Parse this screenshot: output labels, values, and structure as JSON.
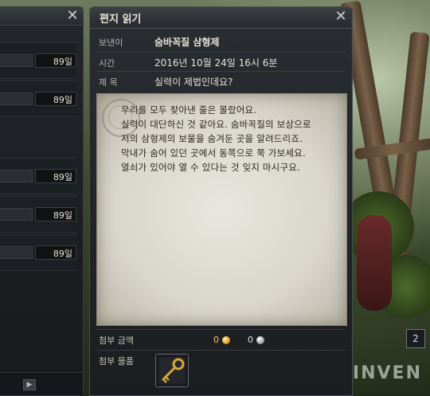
{
  "left_panel": {
    "rows": [
      {
        "days": "89일"
      },
      {
        "days": "89일"
      },
      {
        "days": "89일"
      },
      {
        "days": "89일"
      },
      {
        "days": "89일"
      }
    ],
    "close_label": "✕",
    "pager_next_label": "▶"
  },
  "letter": {
    "title": "편지 읽기",
    "close_label": "✕",
    "sender_label": "보낸이",
    "sender": "숨바꼭질 삼형제",
    "time_label": "시간",
    "time": "2016년 10월 24일 16시 6분",
    "subject_label": "제 목",
    "subject": "실력이 제법인데요?",
    "body_lines": [
      "우리를 모두 찾아낸 줄은 몰랐어요.",
      "실력이 대단하신 것 같아요. 숨바꼭질의 보상으로",
      "저의 삼형제의 보물을 숨겨둔 곳을 알려드리죠.",
      "막내가 숨어 있던 곳에서 동쪽으로 쭉 가보세요.",
      "열쇠가 있어야 열 수 있다는 것 잊지 마시구요."
    ],
    "attach_money_label": "첨부 금액",
    "gold": "0",
    "silver": "0",
    "attach_item_label": "첨부 물품",
    "item_icon": "key-icon"
  },
  "badge": "2",
  "watermark": "INVEN",
  "colors": {
    "gold": "#e5a92a",
    "panel_bg": "#1b1d20",
    "parchment": "#d9d6cc"
  }
}
